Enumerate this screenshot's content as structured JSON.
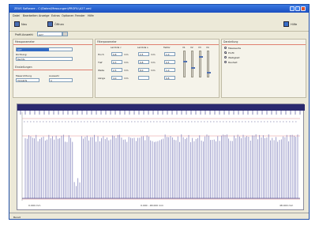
{
  "window": {
    "title": "ZEUS Software - C:\\Daten\\Messungen\\PROFIL\\A27.xml"
  },
  "menu": [
    "Datei",
    "Bearbeiten",
    "Anzeige",
    "Extras",
    "Optionen",
    "Fenster",
    "Hilfe"
  ],
  "toolbar": {
    "new_label": "Neu",
    "open_label": "Öffnen",
    "help_label": "Hilfe"
  },
  "profile_selector": {
    "label": "Profil-Auswahl:",
    "value": "A27"
  },
  "panels": {
    "measurement": {
      "title": "Messparameter",
      "selected_item": "A27",
      "line2": "Richtung:",
      "line3": "Rechts",
      "settings_title": "Einstellungen",
      "col1_label": "Messrichtung",
      "col1_value": "Vorwärts",
      "col2_label": "Auswahl",
      "col2_value": "A"
    },
    "filter": {
      "title": "Filterparameter",
      "col_headers": [
        "Lambda c",
        "Lambda s",
        "Faktor"
      ],
      "row_labels": [
        "Hoch",
        "Tief",
        "Welle",
        "Länge"
      ],
      "values": [
        [
          "0.8",
          "2.5",
          "1.0"
        ],
        [
          "0.3",
          "0.8",
          "0.5"
        ],
        [
          "2.5",
          "8.0",
          "1.0"
        ],
        [
          "4.0",
          "",
          "0.8"
        ]
      ],
      "unit": "mm"
    },
    "amplification": {
      "col_labels": [
        "V1",
        "V2",
        "V3",
        "V4"
      ]
    },
    "display": {
      "title": "Darstellung",
      "options": [
        "Messwerte",
        "Profil",
        "Welligkeit",
        "Rauheit"
      ],
      "selected_index": 1
    }
  },
  "graph": {
    "x_start": "0.000 mm",
    "x_end": "48.000 mm",
    "x_mid": "0.000 - 48.000 mm"
  },
  "status": {
    "text": "Bereit"
  }
}
